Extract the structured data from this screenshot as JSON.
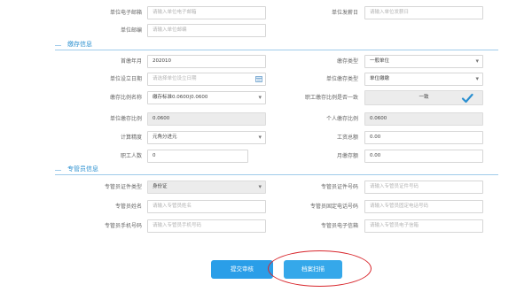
{
  "top": {
    "email_label": "单位电子邮箱",
    "email_placeholder": "请输入单位电子邮箱",
    "payday_label": "单位发薪日",
    "payday_placeholder": "请输入单位发薪日",
    "postcode_label": "单位邮编",
    "postcode_placeholder": "请输入单位邮编"
  },
  "deposit": {
    "section_title": "缴存信息",
    "first_month_label": "首缴年月",
    "first_month_value": "202010",
    "deposit_type_label": "缴存类型",
    "deposit_type_value": "一般单位",
    "established_label": "单位设立日期",
    "established_placeholder": "请选择单位设立日期",
    "unit_deposit_type_label": "单位缴存类型",
    "unit_deposit_type_value": "单位缴缴",
    "ratio_name_label": "缴存比例名称",
    "ratio_name_value": "缴存标准0.0600|0.0600",
    "same_ratio_label": "职工缴存比例是否一致",
    "same_ratio_value": "一致",
    "unit_ratio_label": "单位缴存比例",
    "unit_ratio_value": "0.0600",
    "personal_ratio_label": "个人缴存比例",
    "personal_ratio_value": "0.0600",
    "precision_label": "计算精度",
    "precision_value": "元角分进元",
    "wage_total_label": "工资总额",
    "wage_total_value": "0.00",
    "headcount_label": "职工人数",
    "headcount_value": "0",
    "monthly_amount_label": "月缴存额",
    "monthly_amount_value": "0.00"
  },
  "admin": {
    "section_title": "专管员信息",
    "id_type_label": "专管员证件类型",
    "id_type_value": "身份证",
    "id_number_label": "专管员证件号码",
    "id_number_placeholder": "请输入专管员证件号码",
    "name_label": "专管员姓名",
    "name_placeholder": "请输入专管员姓名",
    "landline_label": "专管员固定电话号码",
    "landline_placeholder": "请输入专管员固定电话号码",
    "mobile_label": "专管员手机号码",
    "mobile_placeholder": "请输入专管员手机号码",
    "email_label": "专管员电子信箱",
    "email_placeholder": "请输入专管员电子信箱"
  },
  "actions": {
    "submit_label": "提交审核",
    "archive_label": "档案扫描"
  },
  "colors": {
    "accent": "#2a8fd0",
    "button": "#2a9ee8",
    "highlight_ring": "#d8262c"
  }
}
